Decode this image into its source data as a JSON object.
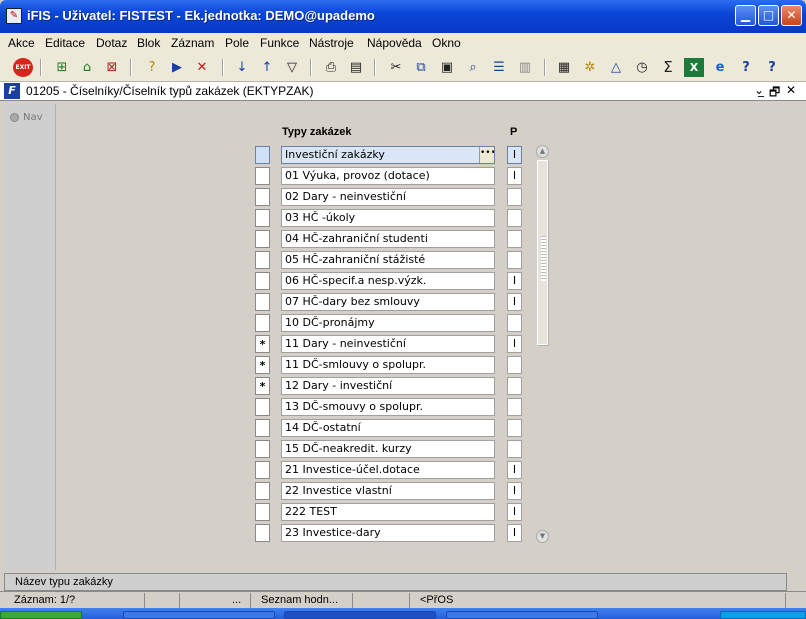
{
  "window": {
    "title": "iFIS - Uživatel: FISTEST - Ek.jednotka: DEMO@upademo"
  },
  "menu": [
    "Akce",
    "Editace",
    "Dotaz",
    "Blok",
    "Záznam",
    "Pole",
    "Funkce",
    "Nástroje",
    "Nápověda",
    "Okno"
  ],
  "toolbar_icons": [
    "exit-icon",
    "insert-record-icon",
    "save-icon",
    "delete-record-icon",
    "query-icon",
    "execute-query-icon",
    "cancel-query-icon",
    "sort-asc-icon",
    "sort-desc-icon",
    "filter-icon",
    "print-icon",
    "print-preview-icon",
    "cut-icon",
    "copy-icon",
    "paste-icon",
    "search-icon",
    "list-icon",
    "columns-icon",
    "calculator-icon",
    "settings-icon",
    "ruler-icon",
    "clock-icon",
    "sum-icon",
    "excel-icon",
    "browser-icon",
    "help-icon",
    "context-help-icon"
  ],
  "form": {
    "title": "01205 - Číselníky/Číselník typů zakázek (EKTYPZAK)",
    "controls": [
      "⌄̲",
      "🗗",
      "✕"
    ],
    "nav_label": "Nav",
    "col_name": "Typy zakázek",
    "col_p": "P",
    "rows": [
      {
        "mark": "",
        "name": "Investiční zakázky",
        "p": "I",
        "selected": true
      },
      {
        "mark": "",
        "name": "01 Výuka, provoz (dotace)",
        "p": "I"
      },
      {
        "mark": "",
        "name": "02 Dary - neinvestiční",
        "p": ""
      },
      {
        "mark": "",
        "name": "03 HČ -úkoly",
        "p": ""
      },
      {
        "mark": "",
        "name": "04 HČ-zahraniční studenti",
        "p": ""
      },
      {
        "mark": "",
        "name": "05 HČ-zahraniční stážisté",
        "p": ""
      },
      {
        "mark": "",
        "name": "06 HČ-specif.a nesp.výzk.",
        "p": "I"
      },
      {
        "mark": "",
        "name": "07 HČ-dary bez smlouvy",
        "p": "I"
      },
      {
        "mark": "",
        "name": "10 DČ-pronájmy",
        "p": ""
      },
      {
        "mark": "*",
        "name": "11 Dary - neinvestiční",
        "p": "I"
      },
      {
        "mark": "*",
        "name": "11 DČ-smlouvy o spolupr.",
        "p": ""
      },
      {
        "mark": "*",
        "name": "12 Dary - investiční",
        "p": ""
      },
      {
        "mark": "",
        "name": "13 DČ-smouvy o spolupr.",
        "p": ""
      },
      {
        "mark": "",
        "name": "14 DČ-ostatní",
        "p": ""
      },
      {
        "mark": "",
        "name": "15 DČ-neakredit. kurzy",
        "p": ""
      },
      {
        "mark": "",
        "name": "21 Investice-účel.dotace",
        "p": "I"
      },
      {
        "mark": "",
        "name": "22 Investice vlastní",
        "p": "I"
      },
      {
        "mark": "",
        "name": "222 TEST",
        "p": "I"
      },
      {
        "mark": "",
        "name": "23 Investice-dary",
        "p": "I"
      }
    ]
  },
  "hint": "Název typu zakázky",
  "status": [
    "Záznam: 1/?",
    "",
    "...",
    "Seznam hodn...",
    "",
    "<PřOS",
    ""
  ]
}
